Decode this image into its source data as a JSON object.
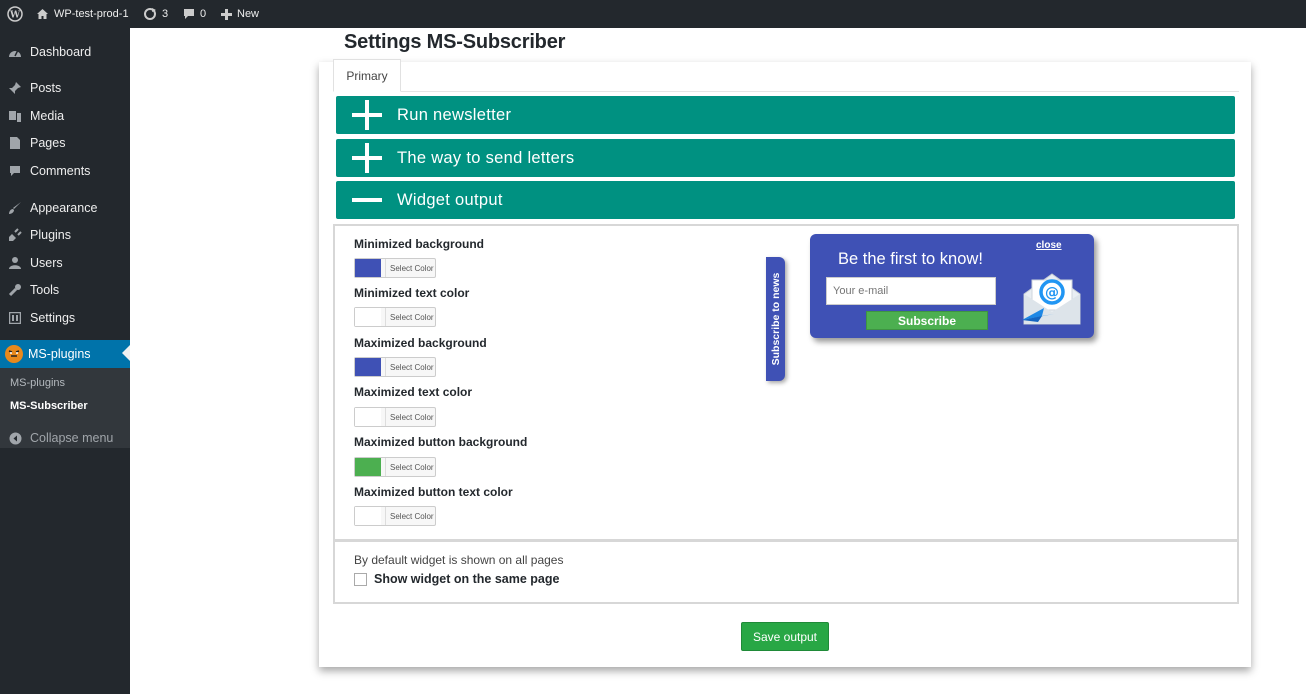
{
  "adminbar": {
    "site_name": "WP-test-prod-1",
    "updates_count": "3",
    "comments_count": "0",
    "new_label": "New"
  },
  "sidebar": {
    "items": [
      {
        "label": "Dashboard",
        "icon": "dashboard-icon"
      },
      {
        "label": "Posts",
        "icon": "pin-icon"
      },
      {
        "label": "Media",
        "icon": "media-icon"
      },
      {
        "label": "Pages",
        "icon": "page-icon"
      },
      {
        "label": "Comments",
        "icon": "comment-icon"
      },
      {
        "label": "Appearance",
        "icon": "brush-icon"
      },
      {
        "label": "Plugins",
        "icon": "plug-icon"
      },
      {
        "label": "Users",
        "icon": "user-icon"
      },
      {
        "label": "Tools",
        "icon": "wrench-icon"
      },
      {
        "label": "Settings",
        "icon": "settings-icon"
      },
      {
        "label": "MS-plugins",
        "icon": "tiger-icon"
      }
    ],
    "submenu": [
      "MS-plugins",
      "MS-Subscriber"
    ],
    "collapse_label": "Collapse menu",
    "active_color": "#0073aa"
  },
  "main": {
    "title": "Settings MS-Subscriber",
    "tab_primary": "Primary",
    "accordions": [
      {
        "label": "Run newsletter",
        "state": "collapsed"
      },
      {
        "label": "The way to send letters",
        "state": "collapsed"
      },
      {
        "label": "Widget output",
        "state": "expanded"
      }
    ],
    "accent_color": "#009181",
    "options": [
      {
        "label": "Minimized background",
        "color": "#3f51b5",
        "button": "Select Color"
      },
      {
        "label": "Minimized text color",
        "color": "#ffffff",
        "button": "Select Color"
      },
      {
        "label": "Maximized background",
        "color": "#3f51b5",
        "button": "Select Color"
      },
      {
        "label": "Maximized text color",
        "color": "#ffffff",
        "button": "Select Color"
      },
      {
        "label": "Maximized button background",
        "color": "#4caf50",
        "button": "Select Color"
      },
      {
        "label": "Maximized button text color",
        "color": "#ffffff",
        "button": "Select Color"
      }
    ],
    "preview": {
      "vertical_tab": "Subscribe to news",
      "title": "Be the first to know!",
      "close": "close",
      "email_placeholder": "Your e-mail",
      "subscribe": "Subscribe"
    },
    "display_note": "By default widget is shown on all pages",
    "same_page_label": "Show widget on the same page",
    "same_page_checked": false,
    "save_label": "Save output"
  }
}
